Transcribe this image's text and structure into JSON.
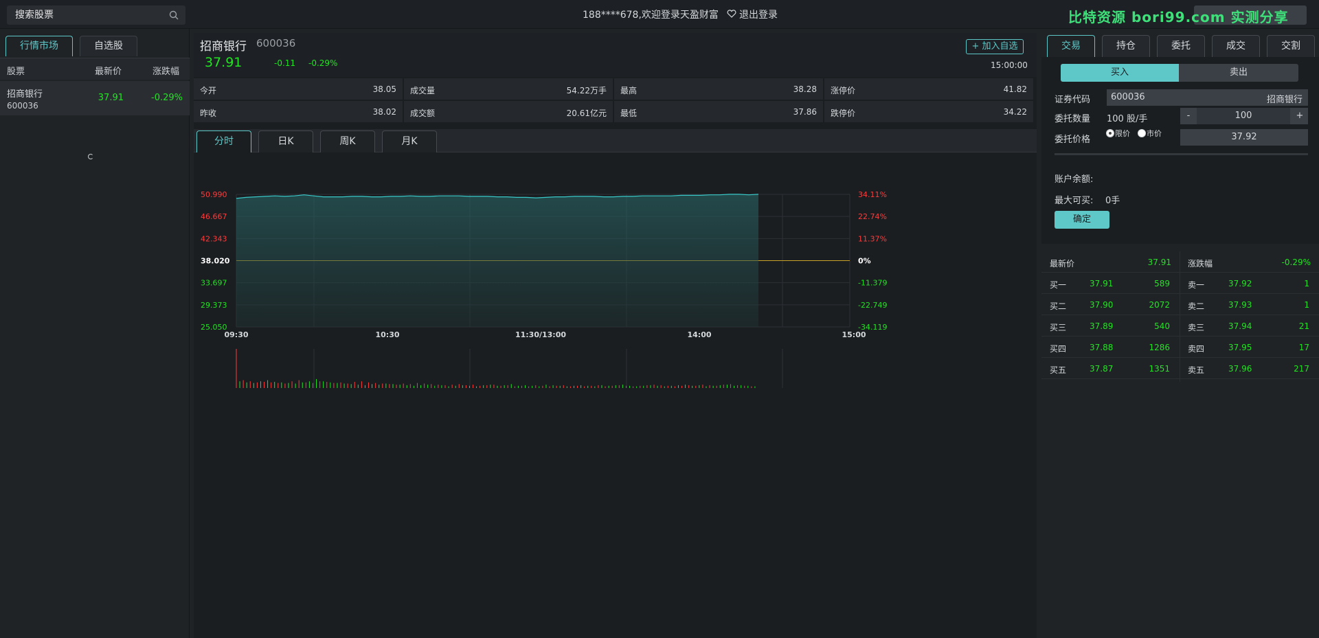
{
  "colors": {
    "up": "#ff3b3b",
    "down": "#22e422",
    "accent": "#5ec7c7",
    "baseline": "#c9a227"
  },
  "topbar": {
    "search_placeholder": "搜索股票",
    "search_icon": "search-icon",
    "welcome": "188****678,欢迎登录天盈财富",
    "logout": "退出登录",
    "logout_icon": "heart-icon",
    "watermark": "比特资源  bori99.com  实测分享"
  },
  "left": {
    "tabs": [
      "行情市场",
      "自选股"
    ],
    "headers": {
      "stock": "股票",
      "price": "最新价",
      "change": "涨跌幅"
    },
    "rows": [
      {
        "name": "招商银行",
        "code": "600036",
        "price": "37.91",
        "change": "-0.29%"
      }
    ]
  },
  "stock": {
    "name": "招商银行",
    "code": "600036",
    "price": "37.91",
    "change": "-0.11",
    "pct": "-0.29%",
    "add_watch": "+ 加入自选",
    "time": "15:00:00",
    "quotes": [
      {
        "k": "今开",
        "v": "38.05",
        "dir": "up"
      },
      {
        "k": "成交量",
        "v": "54.22万手"
      },
      {
        "k": "最高",
        "v": "38.28"
      },
      {
        "k": "涨停价",
        "v": "41.82"
      },
      {
        "k": "昨收",
        "v": "38.02"
      },
      {
        "k": "成交额",
        "v": "20.61亿元"
      },
      {
        "k": "最低",
        "v": "37.86"
      },
      {
        "k": "跌停价",
        "v": "34.22"
      }
    ]
  },
  "chart_tabs": [
    "分时",
    "日K",
    "周K",
    "月K"
  ],
  "chart_data": {
    "type": "line",
    "title": "",
    "ylim": [
      25.05,
      50.99
    ],
    "y_ticks_left": [
      "50.990",
      "46.667",
      "42.343",
      "38.020",
      "33.697",
      "29.373",
      "25.050"
    ],
    "y_ticks_right": [
      "34.11%",
      "22.74%",
      "11.37%",
      "0%",
      "-11.379",
      "-22.749",
      "-34.119"
    ],
    "x_ticks": [
      "09:30",
      "10:30",
      "11:30/13:00",
      "14:00",
      "15:00"
    ],
    "baseline": 38.02,
    "series": [
      {
        "values": [
          50.2,
          50.4,
          50.5,
          50.6,
          50.7,
          50.6,
          50.7,
          50.9,
          50.7,
          50.5,
          50.5,
          50.5,
          50.6,
          50.6,
          50.5,
          50.5,
          50.6,
          50.6,
          50.7,
          50.6,
          50.6,
          50.7,
          50.7,
          50.7,
          50.6,
          50.6,
          50.6,
          50.5,
          50.5,
          50.4,
          50.4,
          50.3,
          50.4,
          50.5,
          50.5,
          50.6,
          50.6,
          50.6,
          50.5,
          50.5,
          50.6,
          50.6,
          50.7,
          50.7,
          50.7,
          50.7,
          50.8,
          50.8,
          50.8,
          50.9,
          50.9,
          51.0,
          51.0,
          50.9,
          51.0
        ]
      }
    ],
    "volume": {
      "up": [
        70,
        14,
        12,
        10,
        11,
        10,
        9,
        8,
        12,
        14,
        10,
        9,
        12,
        11,
        9,
        10,
        8,
        11,
        12,
        10,
        9,
        8,
        7,
        6,
        8,
        7,
        9,
        8,
        7,
        6,
        5,
        6,
        7,
        5,
        6,
        4,
        5,
        6,
        4,
        5,
        3,
        4,
        3,
        5,
        4,
        3,
        4,
        5,
        3,
        4,
        3,
        4,
        5,
        3,
        4,
        5,
        4,
        3,
        4,
        5,
        6,
        5,
        4,
        3,
        4,
        5,
        4,
        6,
        5,
        4,
        6,
        7,
        5,
        4,
        3
      ],
      "down": [
        12,
        10,
        9,
        12,
        14,
        11,
        10,
        9,
        8,
        10,
        12,
        16,
        12,
        10,
        9,
        8,
        7,
        6,
        5,
        7,
        6,
        8,
        7,
        6,
        5,
        4,
        5,
        6,
        4,
        5,
        3,
        4,
        5,
        4,
        3,
        5,
        6,
        4,
        5,
        7,
        4,
        5,
        4,
        3,
        6,
        5,
        4,
        3,
        4,
        5,
        4,
        3,
        5,
        4,
        5,
        6,
        4,
        3,
        4,
        5,
        4,
        3,
        4,
        5,
        6,
        4,
        5,
        3,
        4,
        5,
        6,
        4,
        5,
        4,
        3
      ]
    }
  },
  "right": {
    "tabs": [
      "交易",
      "持仓",
      "委托",
      "成交",
      "交割"
    ],
    "buy": "买入",
    "sell": "卖出",
    "code_label": "证券代码",
    "code_value": "600036",
    "code_name": "招商银行",
    "qty_label": "委托数量",
    "qty_unit": "100 股/手",
    "qty_minus": "-",
    "qty_value": "100",
    "qty_plus": "+",
    "price_label": "委托价格",
    "limit": "限价",
    "market": "市价",
    "price_value": "37.92",
    "balance_label": "账户余额:",
    "max_buy_label": "最大可买:",
    "max_buy_value": "0手",
    "confirm": "确定"
  },
  "book": {
    "latest_label": "最新价",
    "latest_value": "37.91",
    "change_label": "涨跌幅",
    "change_value": "-0.29%",
    "bids": [
      {
        "l": "买一",
        "p": "37.91",
        "v": "589"
      },
      {
        "l": "买二",
        "p": "37.90",
        "v": "2072"
      },
      {
        "l": "买三",
        "p": "37.89",
        "v": "540"
      },
      {
        "l": "买四",
        "p": "37.88",
        "v": "1286"
      },
      {
        "l": "买五",
        "p": "37.87",
        "v": "1351"
      }
    ],
    "asks": [
      {
        "l": "卖一",
        "p": "37.92",
        "v": "1"
      },
      {
        "l": "卖二",
        "p": "37.93",
        "v": "1"
      },
      {
        "l": "卖三",
        "p": "37.94",
        "v": "21"
      },
      {
        "l": "卖四",
        "p": "37.95",
        "v": "17"
      },
      {
        "l": "卖五",
        "p": "37.96",
        "v": "217"
      }
    ]
  }
}
